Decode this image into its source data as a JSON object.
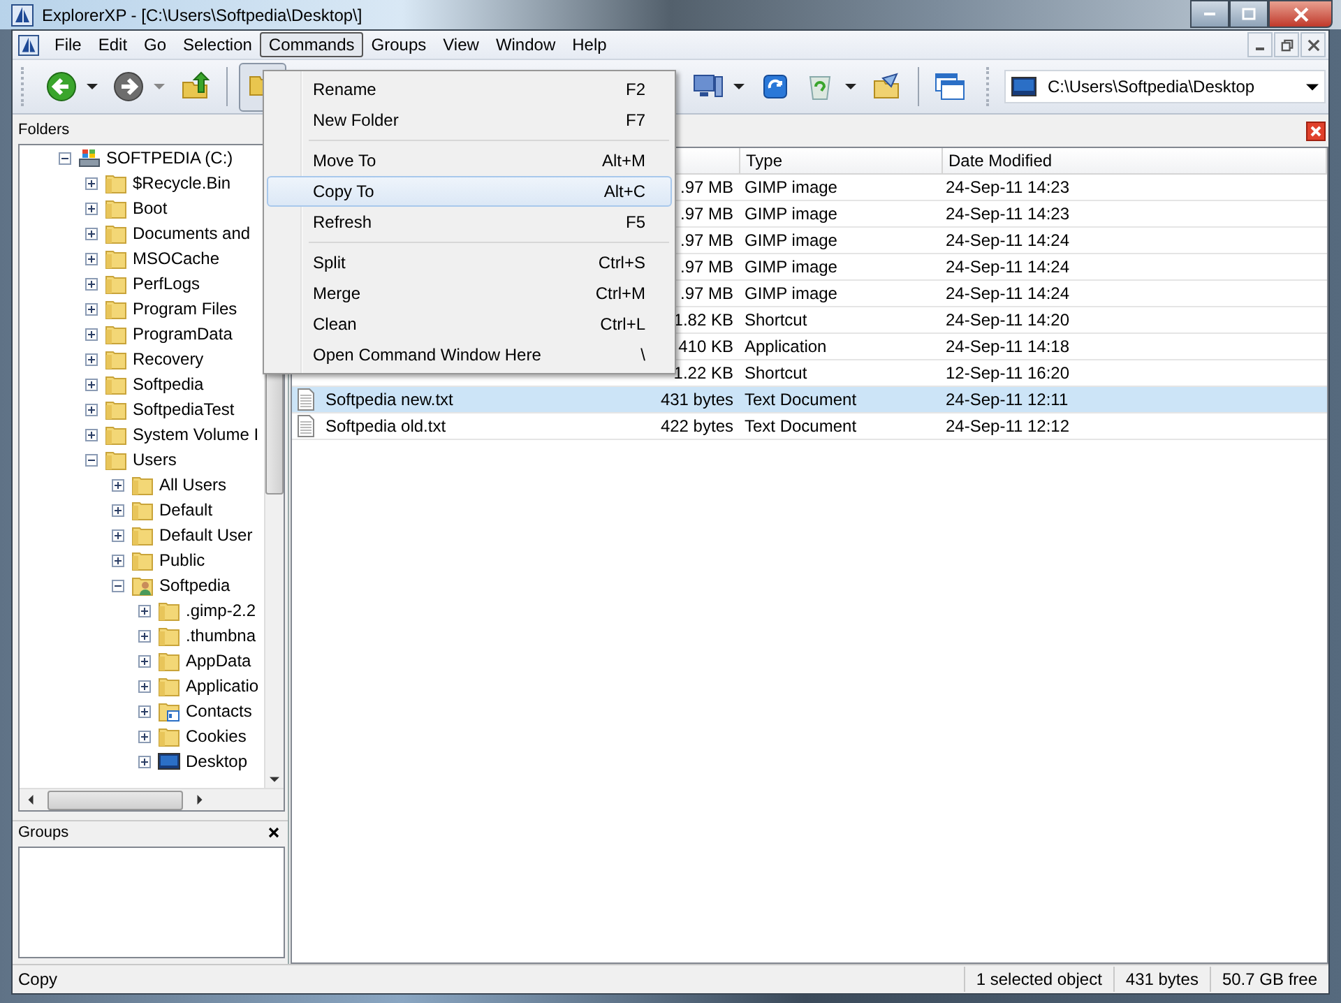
{
  "window": {
    "title": "ExplorerXP - [C:\\Users\\Softpedia\\Desktop\\]"
  },
  "menu_bar": [
    {
      "label": "File",
      "selected": false
    },
    {
      "label": "Edit",
      "selected": false
    },
    {
      "label": "Go",
      "selected": false
    },
    {
      "label": "Selection",
      "selected": false
    },
    {
      "label": "Commands",
      "selected": true
    },
    {
      "label": "Groups",
      "selected": false
    },
    {
      "label": "View",
      "selected": false
    },
    {
      "label": "Window",
      "selected": false
    },
    {
      "label": "Help",
      "selected": false
    }
  ],
  "toolbar": {
    "address": "C:\\Users\\Softpedia\\Desktop"
  },
  "commands_menu": [
    {
      "kind": "item",
      "label": "Rename",
      "shortcut": "F2",
      "selected": false
    },
    {
      "kind": "item",
      "label": "New Folder",
      "shortcut": "F7",
      "selected": false
    },
    {
      "kind": "separator"
    },
    {
      "kind": "item",
      "label": "Move To",
      "shortcut": "Alt+M",
      "selected": false
    },
    {
      "kind": "item",
      "label": "Copy To",
      "shortcut": "Alt+C",
      "selected": true
    },
    {
      "kind": "item",
      "label": "Refresh",
      "shortcut": "F5",
      "selected": false
    },
    {
      "kind": "separator"
    },
    {
      "kind": "item",
      "label": "Split",
      "shortcut": "Ctrl+S",
      "selected": false
    },
    {
      "kind": "item",
      "label": "Merge",
      "shortcut": "Ctrl+M",
      "selected": false
    },
    {
      "kind": "item",
      "label": "Clean",
      "shortcut": "Ctrl+L",
      "selected": false
    },
    {
      "kind": "item",
      "label": "Open Command Window Here",
      "shortcut": "\\",
      "selected": false
    }
  ],
  "folders": {
    "title": "Folders",
    "tree": [
      {
        "label": "SOFTPEDIA (C:)",
        "kind": "drive",
        "expanded": true,
        "children": [
          {
            "label": "$Recycle.Bin",
            "kind": "folder",
            "expanded": false
          },
          {
            "label": "Boot",
            "kind": "folder",
            "expanded": false
          },
          {
            "label": "Documents and",
            "kind": "folder",
            "expanded": false
          },
          {
            "label": "MSOCache",
            "kind": "folder",
            "expanded": false
          },
          {
            "label": "PerfLogs",
            "kind": "folder",
            "expanded": false
          },
          {
            "label": "Program Files",
            "kind": "folder",
            "expanded": false
          },
          {
            "label": "ProgramData",
            "kind": "folder",
            "expanded": false
          },
          {
            "label": "Recovery",
            "kind": "folder",
            "expanded": false
          },
          {
            "label": "Softpedia",
            "kind": "folder",
            "expanded": false
          },
          {
            "label": "SoftpediaTest",
            "kind": "folder",
            "expanded": false
          },
          {
            "label": "System Volume I",
            "kind": "folder",
            "expanded": false
          },
          {
            "label": "Users",
            "kind": "folder",
            "expanded": true,
            "children": [
              {
                "label": "All Users",
                "kind": "folder",
                "expanded": false
              },
              {
                "label": "Default",
                "kind": "folder",
                "expanded": false
              },
              {
                "label": "Default User",
                "kind": "folder",
                "expanded": false
              },
              {
                "label": "Public",
                "kind": "folder",
                "expanded": false
              },
              {
                "label": "Softpedia",
                "kind": "user",
                "expanded": true,
                "children": [
                  {
                    "label": ".gimp-2.2",
                    "kind": "folder",
                    "expanded": false
                  },
                  {
                    "label": ".thumbna",
                    "kind": "folder",
                    "expanded": false
                  },
                  {
                    "label": "AppData",
                    "kind": "folder",
                    "expanded": false
                  },
                  {
                    "label": "Applicatio",
                    "kind": "folder",
                    "expanded": false
                  },
                  {
                    "label": "Contacts",
                    "kind": "contacts",
                    "expanded": false
                  },
                  {
                    "label": "Cookies",
                    "kind": "folder",
                    "expanded": false
                  },
                  {
                    "label": "Desktop",
                    "kind": "desktop",
                    "expanded": false
                  }
                ]
              }
            ]
          }
        ]
      }
    ]
  },
  "groups": {
    "title": "Groups"
  },
  "file_list": {
    "columns": [
      "Type",
      "Date Modified"
    ],
    "rows": [
      {
        "size": ".97 MB",
        "type": "GIMP image",
        "date": "24-Sep-11 14:23",
        "selected": false
      },
      {
        "size": ".97 MB",
        "type": "GIMP image",
        "date": "24-Sep-11 14:23",
        "selected": false
      },
      {
        "size": ".97 MB",
        "type": "GIMP image",
        "date": "24-Sep-11 14:24",
        "selected": false
      },
      {
        "size": ".97 MB",
        "type": "GIMP image",
        "date": "24-Sep-11 14:24",
        "selected": false
      },
      {
        "size": ".97 MB",
        "type": "GIMP image",
        "date": "24-Sep-11 14:24",
        "selected": false
      },
      {
        "size": "1.82 KB",
        "type": "Shortcut",
        "date": "24-Sep-11 14:20",
        "selected": false
      },
      {
        "size": "410 KB",
        "type": "Application",
        "date": "24-Sep-11 14:18",
        "selected": false
      },
      {
        "size": "1.22 KB",
        "type": "Shortcut",
        "date": "12-Sep-11 16:20",
        "selected": false
      },
      {
        "name": "Softpedia new.txt",
        "size": "431 bytes",
        "type": "Text Document",
        "date": "24-Sep-11 12:11",
        "selected": true
      },
      {
        "name": "Softpedia old.txt",
        "size": "422 bytes",
        "type": "Text Document",
        "date": "24-Sep-11 12:12",
        "selected": false
      }
    ]
  },
  "status_bar": [
    "Copy",
    "1 selected object",
    "431 bytes",
    "50.7 GB free"
  ]
}
